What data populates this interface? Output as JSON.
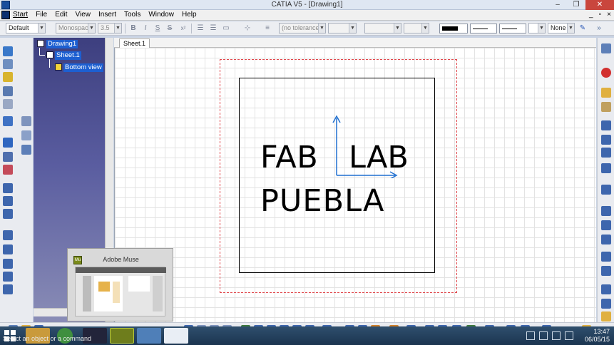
{
  "window": {
    "title": "CATIA V5 - [Drawing1]",
    "controls": [
      "–",
      "❐",
      "✕"
    ]
  },
  "menu": {
    "items": [
      "Start",
      "File",
      "Edit",
      "View",
      "Insert",
      "Tools",
      "Window",
      "Help"
    ],
    "mdi_controls": [
      "_",
      "▫",
      "×"
    ]
  },
  "format_toolbar": {
    "style": "Default",
    "font": "Monospac821",
    "font_size": "3.5",
    "bold": "B",
    "italic": "I",
    "underline": "S",
    "strikethrough": "S",
    "superscript": "x²",
    "tolerance": "(no tolerance)",
    "line_none": "None"
  },
  "tree": {
    "root": "Drawing1",
    "sheet": "Sheet.1",
    "view": "Bottom view"
  },
  "tabs": [
    "Sheet.1"
  ],
  "drawing": {
    "line1_left": "FAB",
    "line1_right": "LAB",
    "line2": "PUEBLA"
  },
  "thumbnail": {
    "title": "Adobe Muse",
    "app_icon": "Mu"
  },
  "taskbar": {
    "time": "13:47",
    "date": "06/05/15",
    "status_text": "Select an object or a command"
  },
  "colors": {
    "tree_bg": "#3d3f7f",
    "page_border": "#e0474c",
    "axis_color": "#1f6fd0",
    "taskbar_bg": "#1b3550"
  }
}
